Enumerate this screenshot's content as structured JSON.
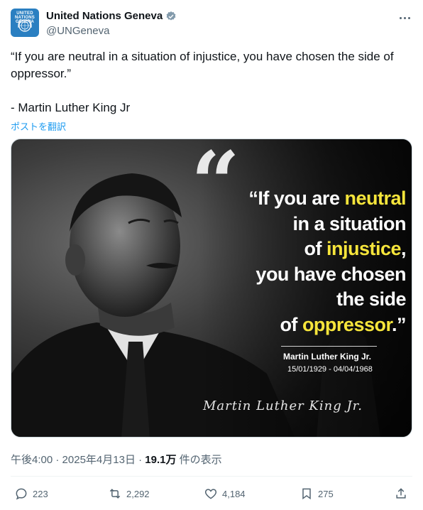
{
  "account": {
    "display_name": "United Nations Geneva",
    "handle": "@UNGeneva",
    "avatar_text": "UNITED NATIONS GENEVA",
    "verified_icon": "verified-badge-icon"
  },
  "tweet": {
    "text": "“If you are neutral in a situation of injustice, you have chosen the side of oppressor.”\n\n- Martin Luther King Jr",
    "translate_label": "ポストを翻訳"
  },
  "image": {
    "quote_mark": "“",
    "quote_lines": [
      {
        "pre": "“If you are ",
        "hl": "neutral",
        "post": ""
      },
      {
        "pre": "in a situation",
        "hl": "",
        "post": ""
      },
      {
        "pre": "of ",
        "hl": "injustice",
        "post": ","
      },
      {
        "pre": "you have chosen",
        "hl": "",
        "post": ""
      },
      {
        "pre": "the side",
        "hl": "",
        "post": ""
      },
      {
        "pre": "of ",
        "hl": "oppressor",
        "post": ".”"
      }
    ],
    "attribution_name": "Martin Luther King Jr.",
    "attribution_dates": "15/01/1929 - 04/04/1968",
    "signature": "Martin Luther King Jr.",
    "highlight_color": "#f6e53b"
  },
  "meta": {
    "time": "午後4:00",
    "separator": "·",
    "date": "2025年4月13日",
    "views_count": "19.1万",
    "views_label": "件の表示"
  },
  "actions": {
    "replies": "223",
    "reposts": "2,292",
    "likes": "4,184",
    "bookmarks": "275"
  },
  "colors": {
    "text_primary": "#0f1419",
    "text_secondary": "#536471",
    "link": "#1d9bf0",
    "verified": "#829aab"
  }
}
